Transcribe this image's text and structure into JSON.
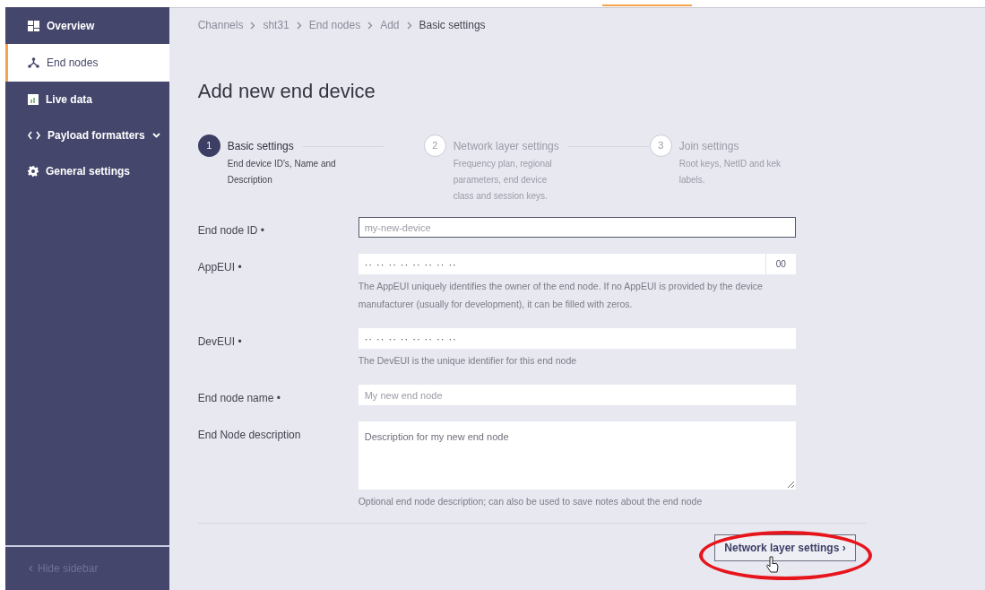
{
  "sidebar": {
    "items": [
      {
        "label": "Overview",
        "selected": false,
        "expandable": false
      },
      {
        "label": "End nodes",
        "selected": true,
        "expandable": false
      },
      {
        "label": "Live data",
        "selected": false,
        "expandable": false
      },
      {
        "label": "Payload formatters",
        "selected": false,
        "expandable": true
      },
      {
        "label": "General settings",
        "selected": false,
        "expandable": false
      }
    ],
    "hide_label": "Hide sidebar"
  },
  "breadcrumb": [
    {
      "label": "Channels",
      "current": false
    },
    {
      "label": "sht31",
      "current": false
    },
    {
      "label": "End nodes",
      "current": false
    },
    {
      "label": "Add",
      "current": false
    },
    {
      "label": "Basic settings",
      "current": true
    }
  ],
  "title": "Add new end device",
  "steps": [
    {
      "number": "1",
      "title": "Basic settings",
      "description": "End device ID's, Name and Description",
      "selected": true
    },
    {
      "number": "2",
      "title": "Network layer settings",
      "description": "Frequency plan, regional parameters, end device class and session keys.",
      "selected": false
    },
    {
      "number": "3",
      "title": "Join settings",
      "description": "Root keys, NetID and kek labels.",
      "selected": false
    }
  ],
  "fields": [
    {
      "kind": "text",
      "label": "End node ID •",
      "placeholder": "my-new-device",
      "focused": true
    },
    {
      "kind": "hex",
      "label": "AppEUI •",
      "placeholder": "·· ·· ·· ·· ·· ·· ·· ··",
      "addon": "00",
      "help": "The AppEUI uniquely identifies the owner of the end node. If no AppEUI is provided by the device manufacturer (usually for development), it can be filled with zeros.",
      "focused": false
    },
    {
      "kind": "hex",
      "label": "DevEUI •",
      "placeholder": "·· ·· ·· ·· ·· ·· ·· ··",
      "help": "The DevEUI is the unique identifier for this end node",
      "focused": false
    },
    {
      "kind": "text",
      "label": "End node name •",
      "placeholder": "My new end node",
      "focused": false
    },
    {
      "kind": "textarea",
      "label": "End Node description",
      "placeholder": "Description for my new end node",
      "help": "Optional end node description; can also be used to save notes about the end node",
      "focused": false
    }
  ],
  "next_button": "Network layer settings ›"
}
